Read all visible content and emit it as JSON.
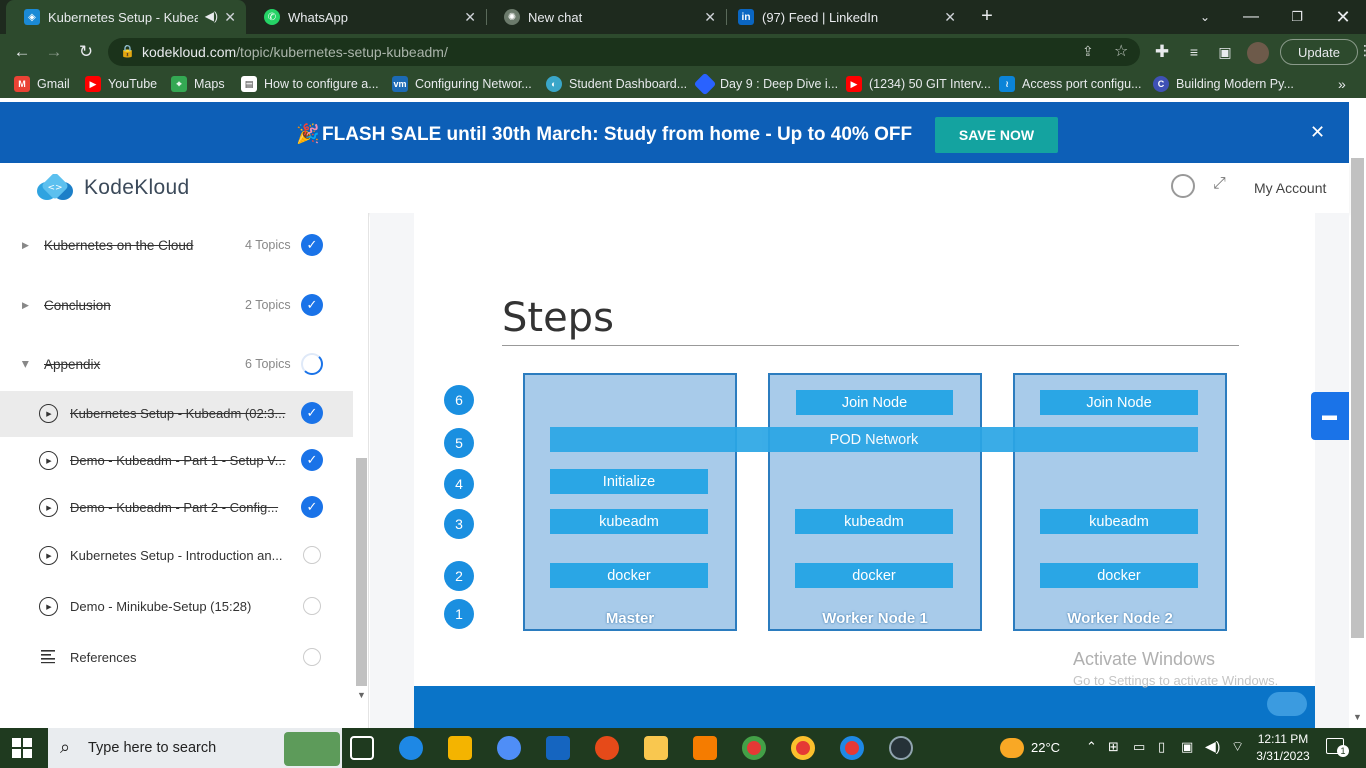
{
  "browser": {
    "tabs": [
      {
        "title": "Kubernetes Setup - Kubeadm",
        "active": true
      },
      {
        "title": "WhatsApp",
        "active": false
      },
      {
        "title": "New chat",
        "active": false
      },
      {
        "title": "(97) Feed | LinkedIn",
        "active": false
      }
    ],
    "new_tab": "+",
    "url_domain": "kodekloud.com",
    "url_path": "/topic/kubernetes-setup-kubeadm/",
    "update_label": "Update",
    "bookmarks": [
      {
        "label": "Gmail",
        "color": "#ea4335"
      },
      {
        "label": "YouTube",
        "color": "#ff0000"
      },
      {
        "label": "Maps",
        "color": "#34a853"
      },
      {
        "label": "How to configure a...",
        "color": "#ffffff"
      },
      {
        "label": "Configuring Networ...",
        "color": "#1c6ab5"
      },
      {
        "label": "Student Dashboard...",
        "color": "#3aa6c9"
      },
      {
        "label": "Day 9 : Deep Dive i...",
        "color": "#2962ff"
      },
      {
        "label": "(1234) 50 GIT Interv...",
        "color": "#ff0000"
      },
      {
        "label": "Access port configu...",
        "color": "#0b84d8"
      },
      {
        "label": "Building Modern Py...",
        "color": "#3f51b5"
      }
    ]
  },
  "banner": {
    "text": "FLASH SALE until 30th March: Study from home - Up to 40% OFF",
    "cta": "SAVE NOW",
    "emoji": "🎉"
  },
  "header": {
    "logo": "KodeKloud",
    "account": "My Account"
  },
  "sidebar": {
    "sections": [
      {
        "title": "Kubernetes on the Cloud",
        "topics": "4 Topics",
        "status": "done"
      },
      {
        "title": "Conclusion",
        "topics": "2 Topics",
        "status": "done"
      },
      {
        "title": "Appendix",
        "topics": "6 Topics",
        "status": "in-progress"
      }
    ],
    "lessons": [
      {
        "title": "Kubernetes Setup - Kubeadm (02:3...",
        "status": "done",
        "struck": true,
        "active": true
      },
      {
        "title": "Demo - Kubeadm - Part 1 - Setup V...",
        "status": "done",
        "struck": true,
        "active": false
      },
      {
        "title": "Demo - Kubeadm - Part 2 - Config...",
        "status": "done",
        "struck": true,
        "active": false
      },
      {
        "title": "Kubernetes Setup - Introduction an...",
        "status": "todo",
        "struck": false,
        "active": false
      },
      {
        "title": "Demo - Minikube-Setup (15:28)",
        "status": "todo",
        "struck": false,
        "active": false
      },
      {
        "title": "References",
        "status": "todo",
        "struck": false,
        "active": false
      }
    ]
  },
  "slide": {
    "title": "Steps",
    "step_numbers": [
      "6",
      "5",
      "4",
      "3",
      "2",
      "1"
    ],
    "pod_network": "POD Network",
    "nodes": [
      {
        "label": "Master",
        "blocks": [
          "Initialize",
          "kubeadm",
          "docker"
        ]
      },
      {
        "label": "Worker Node 1",
        "blocks": [
          "Join Node",
          "kubeadm",
          "docker"
        ]
      },
      {
        "label": "Worker Node 2",
        "blocks": [
          "Join Node",
          "kubeadm",
          "docker"
        ]
      }
    ]
  },
  "watermark": {
    "line1": "Activate Windows",
    "line2": "Go to Settings to activate Windows."
  },
  "taskbar": {
    "search_placeholder": "Type here to search",
    "temperature": "22°C",
    "time": "12:11 PM",
    "date": "3/31/2023",
    "notifications": "1"
  },
  "colors": {
    "banner_bg": "#0d5fb7",
    "cta_bg": "#14a3a0",
    "check_blue": "#1a73e8",
    "slide_block": "#2aa6e5",
    "node_bg": "#a8cbea"
  }
}
